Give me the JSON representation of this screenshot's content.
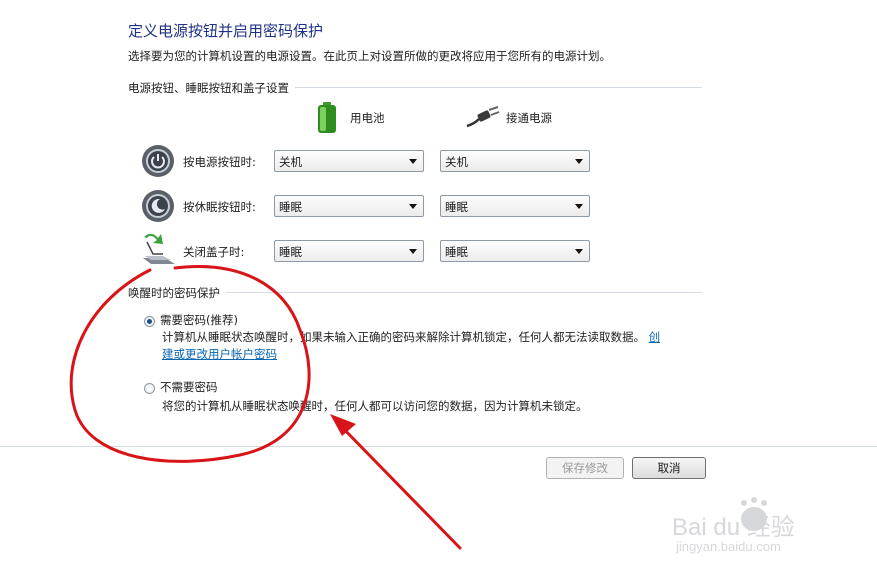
{
  "header": {
    "title": "定义电源按钮并启用密码保护",
    "subtitle": "选择要为您的计算机设置的电源设置。在此页上对设置所做的更改将应用于您所有的电源计划。"
  },
  "power_section": {
    "label": "电源按钮、睡眠按钮和盖子设置",
    "columns": {
      "battery": "用电池",
      "plugged_in": "接通电源"
    },
    "rows": [
      {
        "label": "按电源按钮时:",
        "battery": "关机",
        "plugged_in": "关机",
        "icon": "power-icon"
      },
      {
        "label": "按休眠按钮时:",
        "battery": "睡眠",
        "plugged_in": "睡眠",
        "icon": "sleep-icon"
      },
      {
        "label": "关闭盖子时:",
        "battery": "睡眠",
        "plugged_in": "睡眠",
        "icon": "laptop-lid-icon"
      }
    ]
  },
  "password_section": {
    "label": "唤醒时的密码保护",
    "options": [
      {
        "label": "需要密码(推荐)",
        "selected": true,
        "desc_line1": "计算机从睡眠状态唤醒时，如果未输入正确的密码来解除计算机锁定，任何人都无法读取数据。",
        "link_part1": "创",
        "link_part2": "建或更改用户帐户密码"
      },
      {
        "label": "不需要密码",
        "selected": false,
        "desc_line1": "将您的计算机从睡眠状态唤醒时，任何人都可以访问您的数据，因为计算机未锁定。"
      }
    ]
  },
  "buttons": {
    "save": "保存修改",
    "cancel": "取消"
  },
  "watermark": {
    "brand": "Bai du 经验",
    "url": "jingyan.baidu.com"
  },
  "colors": {
    "title": "#1e3287",
    "link": "#0b66b0",
    "annotation": "#d81418"
  }
}
